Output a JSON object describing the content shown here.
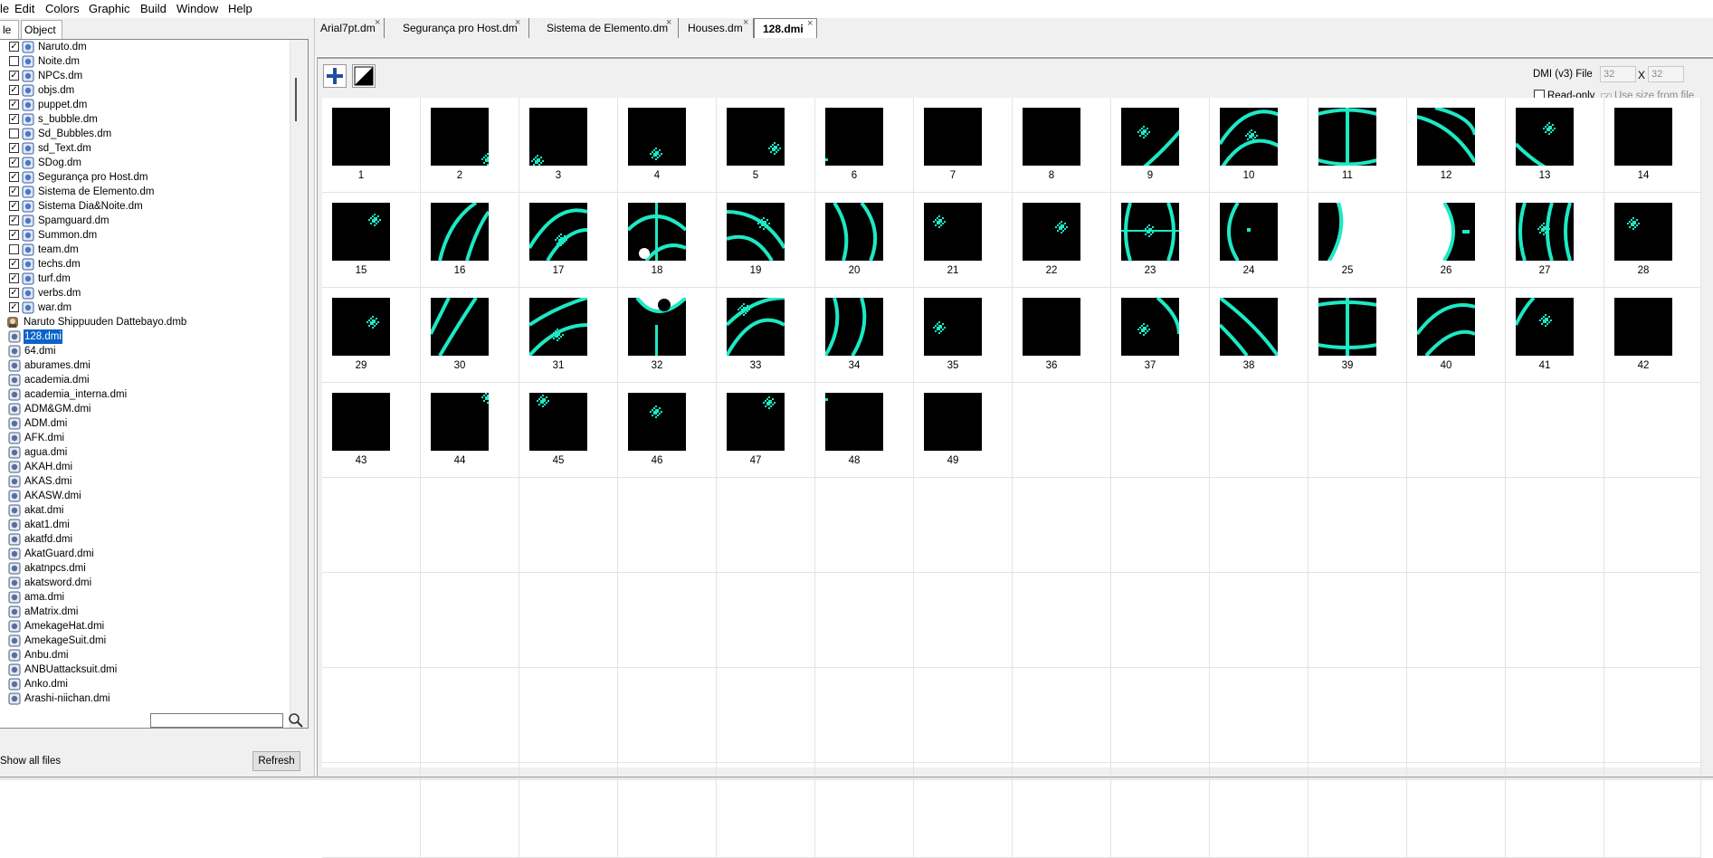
{
  "menubar": {
    "items": [
      "le",
      "Edit",
      "Colors",
      "Graphic",
      "Build",
      "Window",
      "Help"
    ]
  },
  "file_tabs": [
    "le",
    "Object"
  ],
  "tree": [
    {
      "label": "Naruto.dm",
      "kind": "dm",
      "checked": true
    },
    {
      "label": "Noite.dm",
      "kind": "dm",
      "checked": false
    },
    {
      "label": "NPCs.dm",
      "kind": "dm",
      "checked": true
    },
    {
      "label": "objs.dm",
      "kind": "dm",
      "checked": true
    },
    {
      "label": "puppet.dm",
      "kind": "dm",
      "checked": true
    },
    {
      "label": "s_bubble.dm",
      "kind": "dm",
      "checked": true
    },
    {
      "label": "Sd_Bubbles.dm",
      "kind": "dm",
      "checked": false
    },
    {
      "label": "sd_Text.dm",
      "kind": "dm",
      "checked": true
    },
    {
      "label": "SDog.dm",
      "kind": "dm",
      "checked": true
    },
    {
      "label": "Segurança pro Host.dm",
      "kind": "dm",
      "checked": true
    },
    {
      "label": "Sistema de Elemento.dm",
      "kind": "dm",
      "checked": true
    },
    {
      "label": "Sistema Dia&Noite.dm",
      "kind": "dm",
      "checked": true
    },
    {
      "label": "Spamguard.dm",
      "kind": "dm",
      "checked": true
    },
    {
      "label": "Summon.dm",
      "kind": "dm",
      "checked": true
    },
    {
      "label": "team.dm",
      "kind": "dm",
      "checked": false
    },
    {
      "label": "techs.dm",
      "kind": "dm",
      "checked": true
    },
    {
      "label": "turf.dm",
      "kind": "dm",
      "checked": true
    },
    {
      "label": "verbs.dm",
      "kind": "dm",
      "checked": true
    },
    {
      "label": "war.dm",
      "kind": "dm",
      "checked": true
    },
    {
      "label": "Naruto Shippuuden Dattebayo.dmb",
      "kind": "dmb"
    },
    {
      "label": "128.dmi",
      "kind": "dmi",
      "selected": true
    },
    {
      "label": "64.dmi",
      "kind": "dmi"
    },
    {
      "label": "aburames.dmi",
      "kind": "dmi"
    },
    {
      "label": "academia.dmi",
      "kind": "dmi"
    },
    {
      "label": "academia_interna.dmi",
      "kind": "dmi"
    },
    {
      "label": "ADM&GM.dmi",
      "kind": "dmi"
    },
    {
      "label": "ADM.dmi",
      "kind": "dmi"
    },
    {
      "label": "AFK.dmi",
      "kind": "dmi"
    },
    {
      "label": "agua.dmi",
      "kind": "dmi"
    },
    {
      "label": "AKAH.dmi",
      "kind": "dmi"
    },
    {
      "label": "AKAS.dmi",
      "kind": "dmi"
    },
    {
      "label": "AKASW.dmi",
      "kind": "dmi"
    },
    {
      "label": "akat.dmi",
      "kind": "dmi"
    },
    {
      "label": "akat1.dmi",
      "kind": "dmi"
    },
    {
      "label": "akatfd.dmi",
      "kind": "dmi"
    },
    {
      "label": "AkatGuard.dmi",
      "kind": "dmi"
    },
    {
      "label": "akatnpcs.dmi",
      "kind": "dmi"
    },
    {
      "label": "akatsword.dmi",
      "kind": "dmi"
    },
    {
      "label": "ama.dmi",
      "kind": "dmi"
    },
    {
      "label": "aMatrix.dmi",
      "kind": "dmi"
    },
    {
      "label": "AmekageHat.dmi",
      "kind": "dmi"
    },
    {
      "label": "AmekageSuit.dmi",
      "kind": "dmi"
    },
    {
      "label": "Anbu.dmi",
      "kind": "dmi"
    },
    {
      "label": "ANBUattacksuit.dmi",
      "kind": "dmi"
    },
    {
      "label": "Anko.dmi",
      "kind": "dmi"
    },
    {
      "label": "Arashi-niichan.dmi",
      "kind": "dmi"
    }
  ],
  "filter": {
    "value": ""
  },
  "show_all": "Show all files",
  "refresh": "Refresh",
  "doc_tabs": [
    {
      "label": "Arial7pt.dm",
      "active": false
    },
    {
      "label": "Segurança pro Host.dm",
      "active": false
    },
    {
      "label": "Sistema de Elemento.dm",
      "active": false
    },
    {
      "label": "Houses.dm",
      "active": false
    },
    {
      "label": "128.dmi",
      "active": true
    }
  ],
  "close_glyph": "×",
  "dmi": {
    "file_label": "DMI (v3) File",
    "width": "32",
    "x_label": "X",
    "height": "32",
    "read_only": {
      "label": "Read-only",
      "checked": false
    },
    "use_size": {
      "label": "Use size from file",
      "checked": true
    }
  },
  "icons": {
    "count": 49,
    "labels": [
      "1",
      "2",
      "3",
      "4",
      "5",
      "6",
      "7",
      "8",
      "9",
      "10",
      "11",
      "12",
      "13",
      "14",
      "15",
      "16",
      "17",
      "18",
      "19",
      "20",
      "21",
      "22",
      "23",
      "24",
      "25",
      "26",
      "27",
      "28",
      "29",
      "30",
      "31",
      "32",
      "33",
      "34",
      "35",
      "36",
      "37",
      "38",
      "39",
      "40",
      "41",
      "42",
      "43",
      "44",
      "45",
      "46",
      "47",
      "48",
      "49"
    ],
    "columns": 14,
    "rows": 8,
    "colors": {
      "background": "#000000",
      "pattern": "#1de9c5",
      "white": "#ffffff"
    }
  }
}
